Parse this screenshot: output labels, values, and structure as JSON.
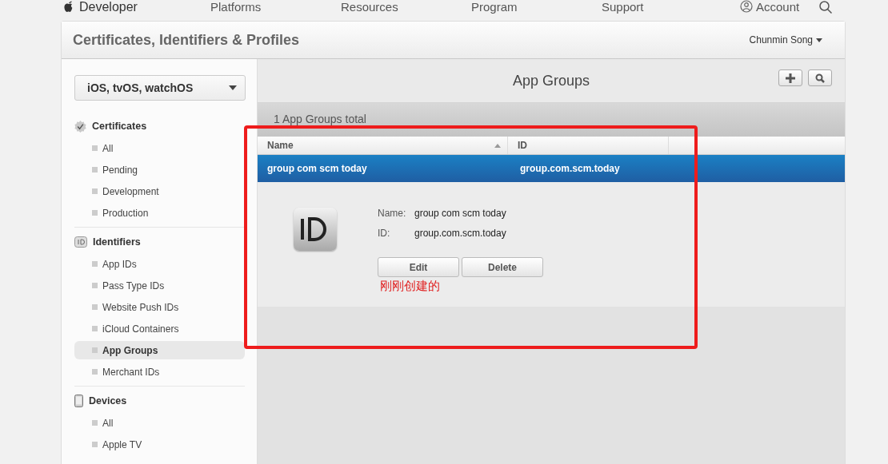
{
  "nav": {
    "brand": "Developer",
    "links": [
      "Platforms",
      "Resources",
      "Program",
      "Support"
    ],
    "account": "Account"
  },
  "header": {
    "title": "Certificates, Identifiers & Profiles",
    "user": "Chunmin Song"
  },
  "sidebar": {
    "platform": "iOS, tvOS, watchOS",
    "sections": [
      {
        "title": "Certificates",
        "kind": "certificate",
        "items": [
          {
            "label": "All",
            "selected": false
          },
          {
            "label": "Pending",
            "selected": false
          },
          {
            "label": "Development",
            "selected": false
          },
          {
            "label": "Production",
            "selected": false
          }
        ]
      },
      {
        "title": "Identifiers",
        "kind": "id",
        "items": [
          {
            "label": "App IDs",
            "selected": false
          },
          {
            "label": "Pass Type IDs",
            "selected": false
          },
          {
            "label": "Website Push IDs",
            "selected": false
          },
          {
            "label": "iCloud Containers",
            "selected": false
          },
          {
            "label": "App Groups",
            "selected": true
          },
          {
            "label": "Merchant IDs",
            "selected": false
          }
        ]
      },
      {
        "title": "Devices",
        "kind": "device",
        "items": [
          {
            "label": "All",
            "selected": false
          },
          {
            "label": "Apple TV",
            "selected": false
          }
        ]
      }
    ]
  },
  "content": {
    "title": "App Groups",
    "summary": "1  App Groups total",
    "columns": [
      {
        "label": "Name",
        "sorted": true
      },
      {
        "label": "ID",
        "sorted": false
      }
    ],
    "rows": [
      {
        "name": "group com scm today",
        "id": "group.com.scm.today",
        "selected": true
      }
    ],
    "detail": {
      "fields": [
        {
          "label": "Name:",
          "value": "group com scm today"
        },
        {
          "label": "ID:",
          "value": "group.com.scm.today"
        }
      ],
      "buttons": [
        "Edit",
        "Delete"
      ]
    },
    "annotation": "刚刚创建的"
  }
}
